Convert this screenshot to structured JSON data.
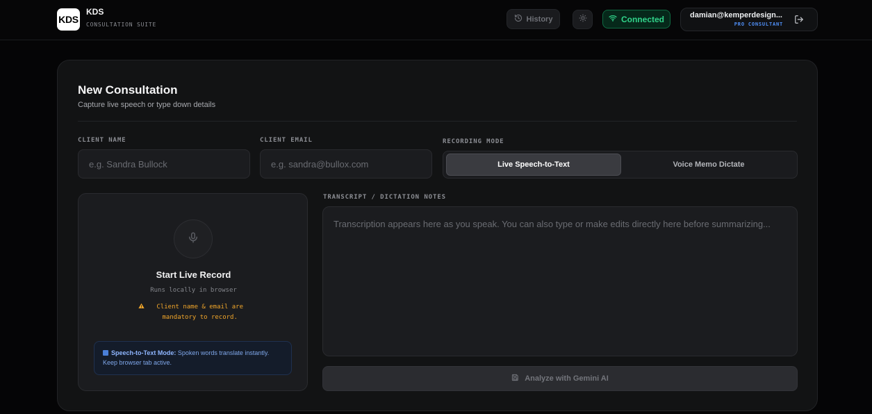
{
  "header": {
    "logo_text": "KDS",
    "brand_title": "KDS",
    "brand_subtitle": "CONSULTATION SUITE",
    "history_label": "History",
    "connection_status": "Connected",
    "user_email": "damian@kemperdesign...",
    "user_role": "PRO CONSULTANT"
  },
  "card": {
    "title": "New Consultation",
    "subtitle": "Capture live speech or type down details",
    "client_name_label": "CLIENT NAME",
    "client_name_placeholder": "e.g. Sandra Bullock",
    "client_email_label": "CLIENT EMAIL",
    "client_email_placeholder": "e.g. sandra@bullox.com",
    "recording_mode_label": "RECORDING MODE",
    "modes": [
      {
        "label": "Live Speech-to-Text",
        "active": true
      },
      {
        "label": "Voice Memo Dictate",
        "active": false
      }
    ]
  },
  "record_panel": {
    "title": "Start Live Record",
    "subtitle": "Runs locally in browser",
    "warning": "Client name & email are mandatory to record.",
    "info_title": "Speech-to-Text Mode:",
    "info_text": "Spoken words translate instantly. Keep browser tab active."
  },
  "transcript": {
    "label": "TRANSCRIPT / DICTATION NOTES",
    "placeholder": "Transcription appears here as you speak. You can also type or make edits directly here before summarizing...",
    "value": ""
  },
  "analyze_button": "Analyze with Gemini AI",
  "colors": {
    "background": "#050506",
    "card": "#121314",
    "accent_green": "#31d38a",
    "accent_blue": "#4f8ff7",
    "warning": "#f0a52a"
  }
}
